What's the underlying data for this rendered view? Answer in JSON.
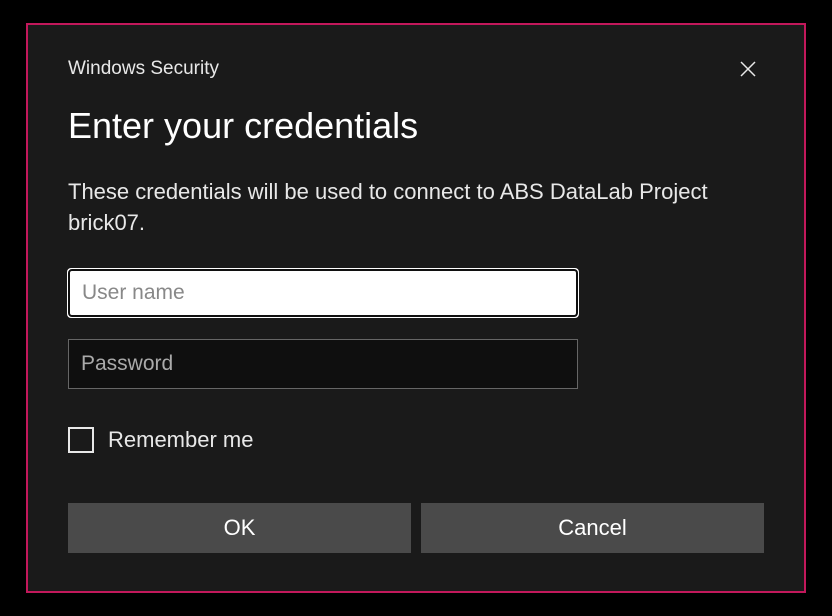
{
  "dialog": {
    "title": "Windows Security",
    "heading": "Enter your credentials",
    "description": "These credentials will be used to connect to ABS DataLab Project brick07.",
    "username": {
      "placeholder": "User name",
      "value": ""
    },
    "password": {
      "placeholder": "Password",
      "value": ""
    },
    "remember_label": "Remember me",
    "remember_checked": false,
    "buttons": {
      "ok": "OK",
      "cancel": "Cancel"
    },
    "accent_color": "#e91e63"
  }
}
